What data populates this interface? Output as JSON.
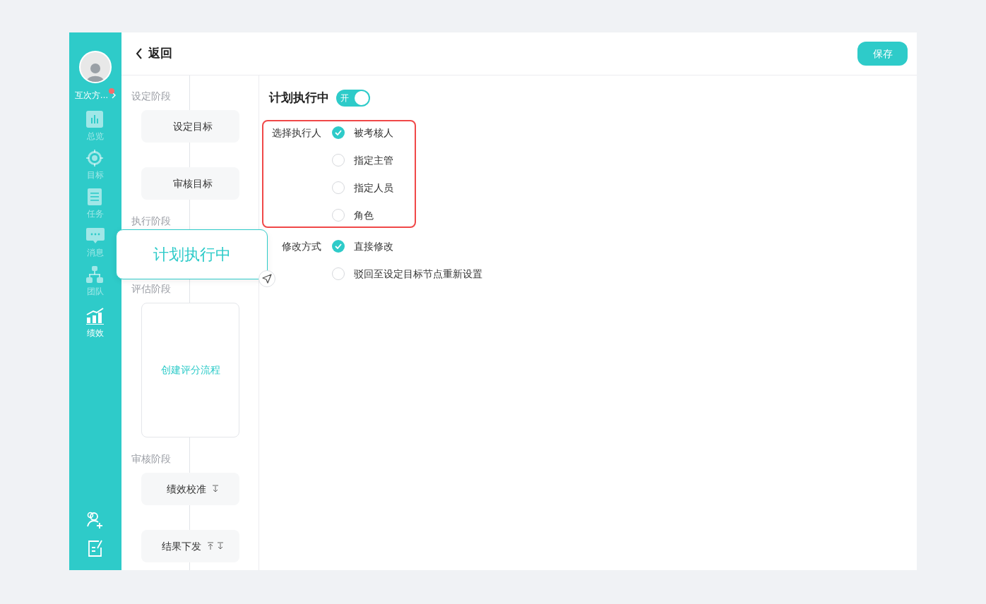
{
  "sidebar": {
    "user": {
      "name": "互次方…",
      "has_notification": true
    },
    "nav": [
      {
        "label": "总览",
        "selected": false
      },
      {
        "label": "目标",
        "selected": false
      },
      {
        "label": "任务",
        "selected": false
      },
      {
        "label": "消息",
        "selected": false
      },
      {
        "label": "团队",
        "selected": false
      },
      {
        "label": "绩效",
        "selected": true
      }
    ]
  },
  "header": {
    "back_label": "返回",
    "save_button": "保存"
  },
  "flow": {
    "stages": [
      {
        "label": "设定阶段",
        "nodes": [
          {
            "kind": "step",
            "label": "设定目标"
          },
          {
            "kind": "step",
            "label": "审核目标"
          }
        ]
      },
      {
        "label": "执行阶段",
        "nodes": [
          {
            "kind": "popout",
            "label": "计划执行中"
          }
        ]
      },
      {
        "label": "评估阶段",
        "nodes": [
          {
            "kind": "create",
            "label": "创建评分流程"
          }
        ]
      },
      {
        "label": "审核阶段",
        "nodes": [
          {
            "kind": "step",
            "label": "绩效校准",
            "move_up": false,
            "move_down": true
          },
          {
            "kind": "step",
            "label": "结果下发",
            "move_up": true,
            "move_down": true
          }
        ]
      }
    ]
  },
  "settings": {
    "title": "计划执行中",
    "toggle": {
      "on": true,
      "label": "开"
    },
    "groups": [
      {
        "label": "选择执行人",
        "highlighted": true,
        "options": [
          {
            "label": "被考核人",
            "selected": true
          },
          {
            "label": "指定主管",
            "selected": false
          },
          {
            "label": "指定人员",
            "selected": false
          },
          {
            "label": "角色",
            "selected": false
          }
        ]
      },
      {
        "label": "修改方式",
        "highlighted": false,
        "options": [
          {
            "label": "直接修改",
            "selected": true
          },
          {
            "label": "驳回至设定目标节点重新设置",
            "selected": false
          }
        ]
      }
    ]
  }
}
